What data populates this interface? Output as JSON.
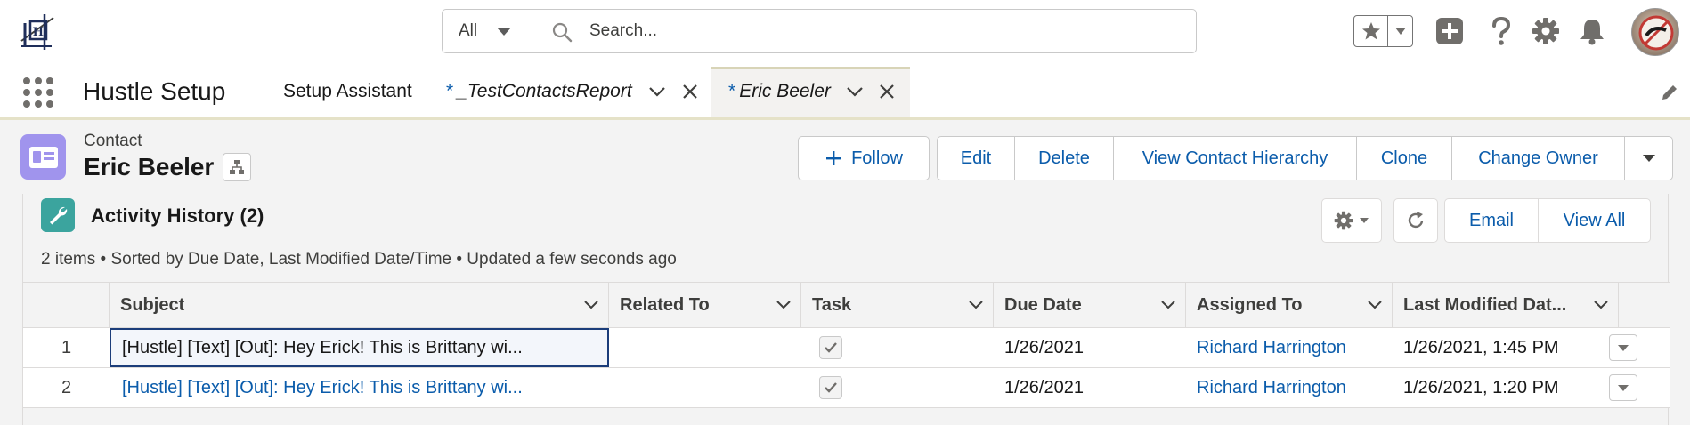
{
  "global_header": {
    "search_scope": "All",
    "search_placeholder": "Search...",
    "icons": [
      "logo-icon",
      "search-icon",
      "favorites-star-icon",
      "chevron-down-icon",
      "global-actions-plus-icon",
      "help-icon",
      "setup-gear-icon",
      "notifications-bell-icon",
      "avatar"
    ]
  },
  "nav": {
    "app_name": "Hustle Setup",
    "items": [
      {
        "label": "Setup Assistant",
        "dirty": false
      },
      {
        "label": "_TestContactsReport",
        "dirty": true,
        "star": "*"
      },
      {
        "label": "Eric Beeler",
        "dirty": true,
        "star": "*",
        "active": true
      }
    ]
  },
  "record": {
    "object_label": "Contact",
    "name": "Eric Beeler",
    "follow_label": "Follow",
    "actions": [
      "Edit",
      "Delete",
      "View Contact Hierarchy",
      "Clone",
      "Change Owner"
    ]
  },
  "activity_history": {
    "title": "Activity History (2)",
    "subtitle": "2 items • Sorted by Due Date, Last Modified Date/Time • Updated a few seconds ago",
    "actions": [
      "Email",
      "View All"
    ],
    "columns": [
      "Subject",
      "Related To",
      "Task",
      "Due Date",
      "Assigned To",
      "Last Modified Dat..."
    ],
    "rows": [
      {
        "num": "1",
        "subject": "[Hustle] [Text] [Out]: Hey Erick! This is Brittany wi...",
        "related_to": "",
        "task": true,
        "due_date": "1/26/2021",
        "assigned_to": "Richard Harrington",
        "last_modified": "1/26/2021, 1:45 PM"
      },
      {
        "num": "2",
        "subject": "[Hustle] [Text] [Out]: Hey Erick! This is Brittany wi...",
        "related_to": "",
        "task": true,
        "due_date": "1/26/2021",
        "assigned_to": "Richard Harrington",
        "last_modified": "1/26/2021, 1:20 PM"
      }
    ]
  },
  "colors": {
    "brand_blue": "#0b5cab",
    "contact_icon": "#a094ed",
    "activity_icon": "#3ba49e"
  }
}
